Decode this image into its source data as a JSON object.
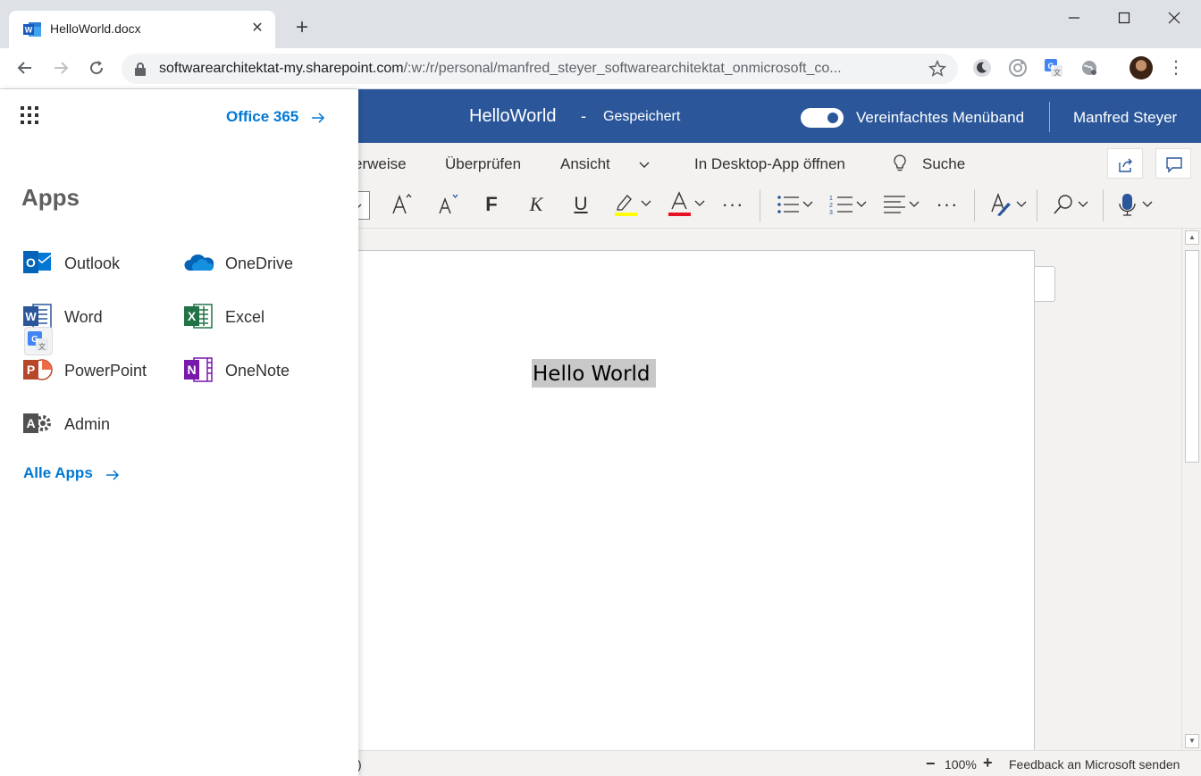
{
  "browser": {
    "tab_title": "HelloWorld.docx",
    "new_tab": "+",
    "url_host": "softwarearchitektat-my.sharepoint.com",
    "url_rest": "/:w:/r/personal/manfred_steyer_softwarearchitektat_onmicrosoft_co..."
  },
  "word": {
    "doc_title": "HelloWorld",
    "dash": "-",
    "save_status": "Gespeichert",
    "simplified_ribbon_label": "Vereinfachtes Menüband",
    "simplified_ribbon_on": true,
    "user_name": "Manfred Steyer",
    "brand_color": "#2b579a"
  },
  "ribbon": {
    "menu": {
      "references_partial": "erweise",
      "review": "Überprüfen",
      "view": "Ansicht",
      "open_desktop": "In Desktop-App öffnen",
      "search": "Suche"
    },
    "bold": "F",
    "italic": "K",
    "underline": "U",
    "font_color_letter": "A",
    "highlight_color": "#ffff00",
    "font_color": "#e81123"
  },
  "document": {
    "text": "Hello World"
  },
  "statusbar": {
    "paren": ")",
    "zoom_minus": "−",
    "zoom": "100%",
    "zoom_plus": "+",
    "feedback": "Feedback an Microsoft senden"
  },
  "launcher": {
    "office_link": "Office 365",
    "heading": "Apps",
    "apps": [
      {
        "label": "Outlook",
        "icon": "outlook-icon"
      },
      {
        "label": "OneDrive",
        "icon": "onedrive-icon"
      },
      {
        "label": "Word",
        "icon": "word-icon"
      },
      {
        "label": "Excel",
        "icon": "excel-icon"
      },
      {
        "label": "PowerPoint",
        "icon": "powerpoint-icon"
      },
      {
        "label": "OneNote",
        "icon": "onenote-icon"
      },
      {
        "label": "Admin",
        "icon": "admin-icon"
      }
    ],
    "all_apps": "Alle Apps"
  }
}
